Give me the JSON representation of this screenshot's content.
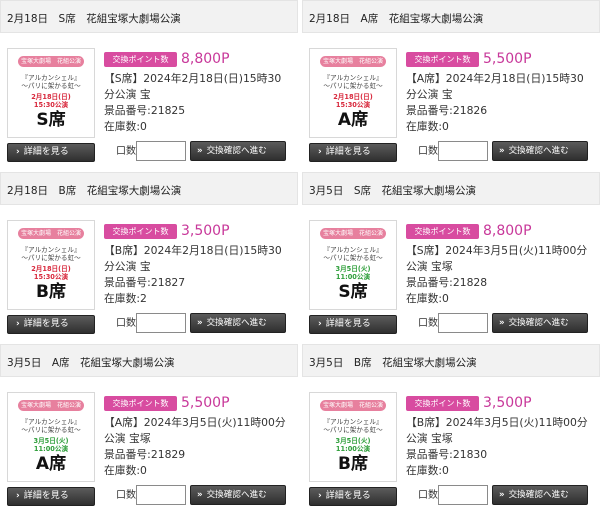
{
  "common": {
    "badge_label": "交換ポイント数",
    "detail_button": "詳細を見る",
    "exchange_button": "交換確認へ進む",
    "qty_label": "口数",
    "detail_arrow": "›",
    "exchange_arrow": "»",
    "poster_brand": "宝塚大劇場　花組公演",
    "poster_title": "『アルカンシェル』",
    "poster_subtitle": "～パリに架かる虹～"
  },
  "colors": {
    "badge": "#d84ca0",
    "points": "#c8389a",
    "poster_brand": "#e7809e",
    "poster_date_red": "#d8283c",
    "poster_date_green": "#2e9e3a"
  },
  "cards": [
    {
      "header": "2月18日　S席　花組宝塚大劇場公演",
      "points": "8,800P",
      "description": "【S席】2024年2月18日(日)15時30分公演 宝",
      "item_no": "景品番号:21825",
      "stock": "在庫数:0",
      "poster_date": "2月18日(日)",
      "poster_time": "15:30公演",
      "poster_seat": "S席",
      "poster_color": "#d8283c"
    },
    {
      "header": "2月18日　A席　花組宝塚大劇場公演",
      "points": "5,500P",
      "description": "【A席】2024年2月18日(日)15時30分公演 宝",
      "item_no": "景品番号:21826",
      "stock": "在庫数:0",
      "poster_date": "2月18日(日)",
      "poster_time": "15:30公演",
      "poster_seat": "A席",
      "poster_color": "#d8283c"
    },
    {
      "header": "2月18日　B席　花組宝塚大劇場公演",
      "points": "3,500P",
      "description": "【B席】2024年2月18日(日)15時30分公演 宝",
      "item_no": "景品番号:21827",
      "stock": "在庫数:2",
      "poster_date": "2月18日(日)",
      "poster_time": "15:30公演",
      "poster_seat": "B席",
      "poster_color": "#d8283c"
    },
    {
      "header": "3月5日　S席　花組宝塚大劇場公演",
      "points": "8,800P",
      "description": "【S席】2024年3月5日(火)11時00分公演 宝塚",
      "item_no": "景品番号:21828",
      "stock": "在庫数:0",
      "poster_date": "3月5日(火)",
      "poster_time": "11:00公演",
      "poster_seat": "S席",
      "poster_color": "#2e9e3a"
    },
    {
      "header": "3月5日　A席　花組宝塚大劇場公演",
      "points": "5,500P",
      "description": "【A席】2024年3月5日(火)11時00分公演 宝塚",
      "item_no": "景品番号:21829",
      "stock": "在庫数:0",
      "poster_date": "3月5日(火)",
      "poster_time": "11:00公演",
      "poster_seat": "A席",
      "poster_color": "#2e9e3a"
    },
    {
      "header": "3月5日　B席　花組宝塚大劇場公演",
      "points": "3,500P",
      "description": "【B席】2024年3月5日(火)11時00分公演 宝塚",
      "item_no": "景品番号:21830",
      "stock": "在庫数:0",
      "poster_date": "3月5日(火)",
      "poster_time": "11:00公演",
      "poster_seat": "B席",
      "poster_color": "#2e9e3a"
    }
  ]
}
